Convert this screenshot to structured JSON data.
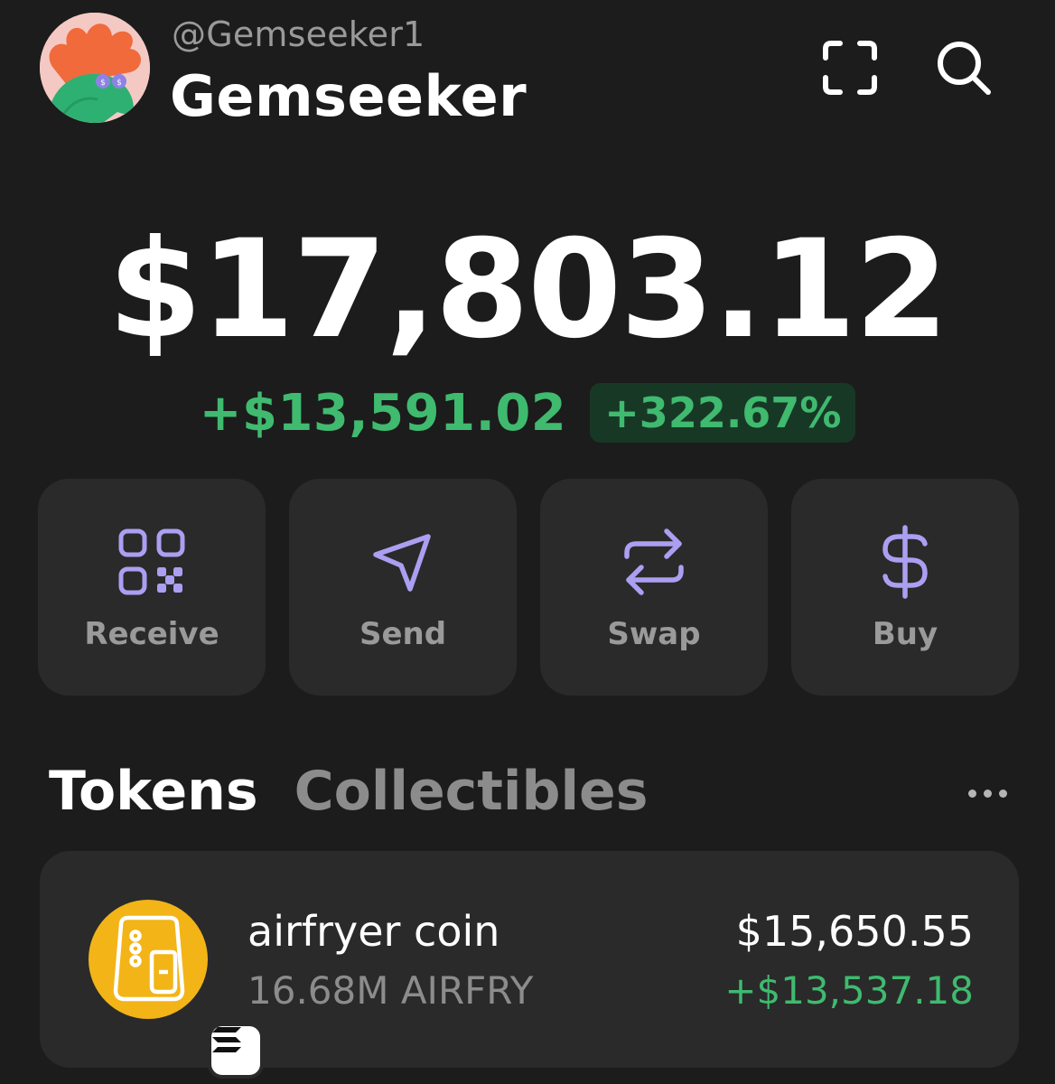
{
  "profile": {
    "handle": "@Gemseeker1",
    "name": "Gemseeker"
  },
  "header_icons": [
    "scan-icon",
    "search-icon"
  ],
  "balance": {
    "total": "$17,803.12",
    "change_abs": "+$13,591.02",
    "change_pct": "+322.67%"
  },
  "actions": [
    {
      "label": "Receive",
      "icon": "qr-code-icon"
    },
    {
      "label": "Send",
      "icon": "send-icon"
    },
    {
      "label": "Swap",
      "icon": "swap-icon"
    },
    {
      "label": "Buy",
      "icon": "dollar-icon"
    }
  ],
  "tabs": [
    {
      "label": "Tokens",
      "active": true
    },
    {
      "label": "Collectibles",
      "active": false
    }
  ],
  "tokens": [
    {
      "name": "airfryer coin",
      "amount": "16.68M AIRFRY",
      "value": "$15,650.55",
      "change": "+$13,537.18",
      "icon": "airfryer-icon",
      "chain_icon": "solana-icon"
    }
  ],
  "colors": {
    "background": "#1c1c1c",
    "card": "#2a2a2a",
    "accent": "#ab9ff2",
    "positive": "#3fba6f",
    "muted": "#8c8c8c"
  }
}
